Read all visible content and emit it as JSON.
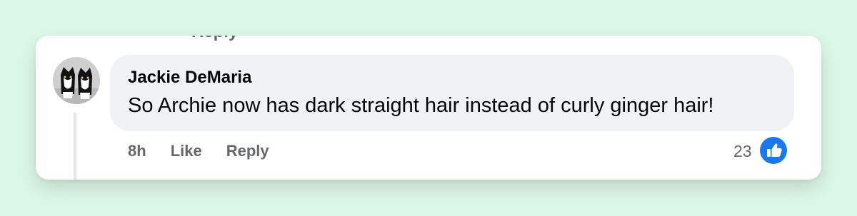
{
  "previous_comment": {
    "partial_action": "Reply"
  },
  "comment": {
    "author": "Jackie DeMaria",
    "text": "So Archie now has dark straight hair instead of curly ginger hair!",
    "timestamp": "8h",
    "like_label": "Like",
    "reply_label": "Reply",
    "reaction_count": "23",
    "reaction_icon": "thumbs-up-icon"
  },
  "colors": {
    "page_background": "#dcf8e8",
    "card_background": "#ffffff",
    "bubble_background": "#f0f2f5",
    "secondary_text": "#65676b",
    "like_blue": "#1877f2"
  }
}
